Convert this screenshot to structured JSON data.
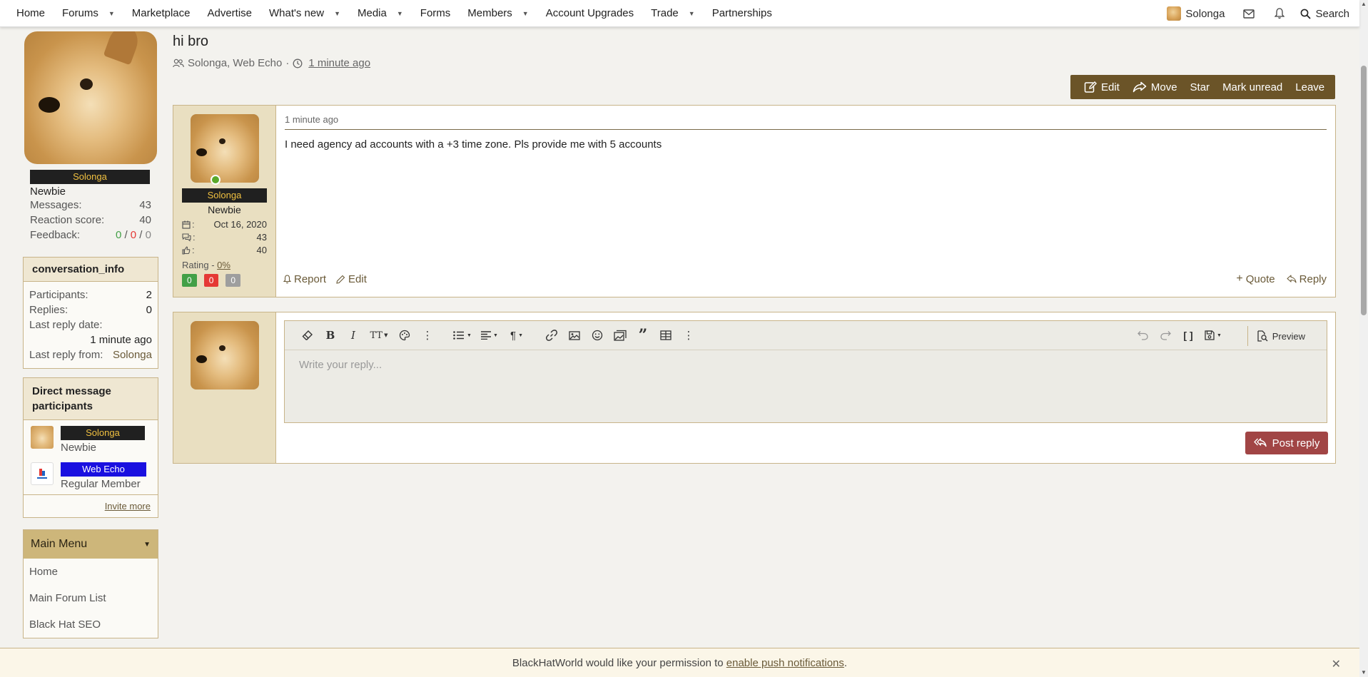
{
  "nav": {
    "items": [
      {
        "label": "Home",
        "caret": false
      },
      {
        "label": "Forums",
        "caret": true
      },
      {
        "label": "Marketplace",
        "caret": false
      },
      {
        "label": "Advertise",
        "caret": false
      },
      {
        "label": "What's new",
        "caret": true
      },
      {
        "label": "Media",
        "caret": true
      },
      {
        "label": "Forms",
        "caret": false
      },
      {
        "label": "Members",
        "caret": true
      },
      {
        "label": "Account Upgrades",
        "caret": false
      },
      {
        "label": "Trade",
        "caret": true
      },
      {
        "label": "Partnerships",
        "caret": false
      }
    ],
    "username": "Solonga",
    "search_label": "Search"
  },
  "sidebar": {
    "username": "Solonga",
    "user_title": "Newbie",
    "stats": {
      "messages_label": "Messages:",
      "messages": "43",
      "reaction_label": "Reaction score:",
      "reaction": "40",
      "feedback_label": "Feedback:",
      "feedback_pos": "0",
      "feedback_neg": "0",
      "feedback_neu": "0"
    },
    "info": {
      "title": "conversation_info",
      "participants_label": "Participants:",
      "participants": "2",
      "replies_label": "Replies:",
      "replies": "0",
      "last_reply_date_label": "Last reply date:",
      "last_reply_date": "1 minute ago",
      "last_reply_from_label": "Last reply from:",
      "last_reply_from": "Solonga"
    },
    "participants": {
      "title": "Direct message participants",
      "list": [
        {
          "name": "Solonga",
          "title": "Newbie"
        },
        {
          "name": "Web Echo",
          "title": "Regular Member"
        }
      ],
      "invite_label": "Invite more"
    },
    "menu": {
      "title": "Main Menu",
      "items": [
        "Home",
        "Main Forum List",
        "Black Hat SEO"
      ]
    }
  },
  "conversation": {
    "title": "hi bro",
    "participants": "Solonga, Web Echo",
    "time": "1 minute ago"
  },
  "actions": [
    "Edit",
    "Move",
    "Star",
    "Mark unread",
    "Leave"
  ],
  "post": {
    "username": "Solonga",
    "user_title": "Newbie",
    "joined": "Oct 16, 2020",
    "messages": "43",
    "reactions": "40",
    "rating_label": "Rating - ",
    "rating_value": "0%",
    "votes": [
      "0",
      "0",
      "0"
    ],
    "date": "1 minute ago",
    "text": "I need agency ad accounts with a +3 time zone. Pls provide me with 5 accounts",
    "report_label": "Report",
    "edit_label": "Edit",
    "quote_label": "Quote",
    "reply_label": "Reply"
  },
  "editor": {
    "placeholder": "Write your reply...",
    "preview_label": "Preview",
    "post_reply_label": "Post reply"
  },
  "push_bar": {
    "text_before": "BlackHatWorld would like your permission to ",
    "link": "enable push notifications",
    "text_after": "."
  },
  "colors": {
    "accent": "#6b5428",
    "post_reply": "#a14545",
    "header_band": "#cdb67a",
    "positive": "#43a047",
    "negative": "#e53935",
    "neutral": "#9e9e9e"
  }
}
